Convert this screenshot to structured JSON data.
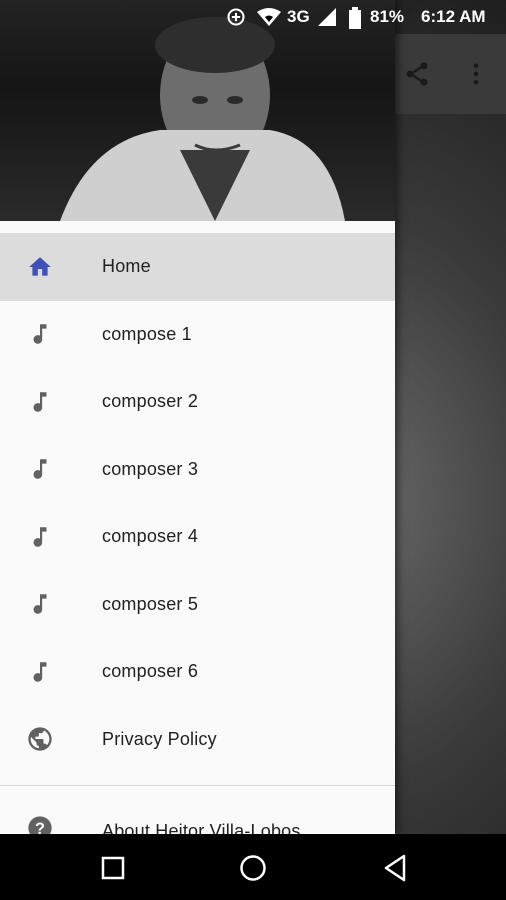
{
  "status_bar": {
    "battery": "81%",
    "network": "3G",
    "time": "6:12 AM"
  },
  "toolbar": {
    "share_icon": "share-icon",
    "more_icon": "more-vert-icon"
  },
  "drawer": {
    "menu": [
      {
        "label": "Home",
        "icon": "home-icon",
        "active": true
      },
      {
        "label": "compose 1",
        "icon": "music-note-icon"
      },
      {
        "label": "composer 2",
        "icon": "music-note-icon"
      },
      {
        "label": "composer 3",
        "icon": "music-note-icon"
      },
      {
        "label": "composer 4",
        "icon": "music-note-icon"
      },
      {
        "label": "composer 5",
        "icon": "music-note-icon"
      },
      {
        "label": "composer 6",
        "icon": "music-note-icon"
      },
      {
        "label": "Privacy Policy",
        "icon": "globe-icon"
      }
    ],
    "about": {
      "label": "About Heitor Villa-Lobos",
      "icon": "help-icon"
    }
  },
  "colors": {
    "active_icon": "#3f51b5",
    "icon": "#616161",
    "active_bg": "#dcdcdc"
  }
}
